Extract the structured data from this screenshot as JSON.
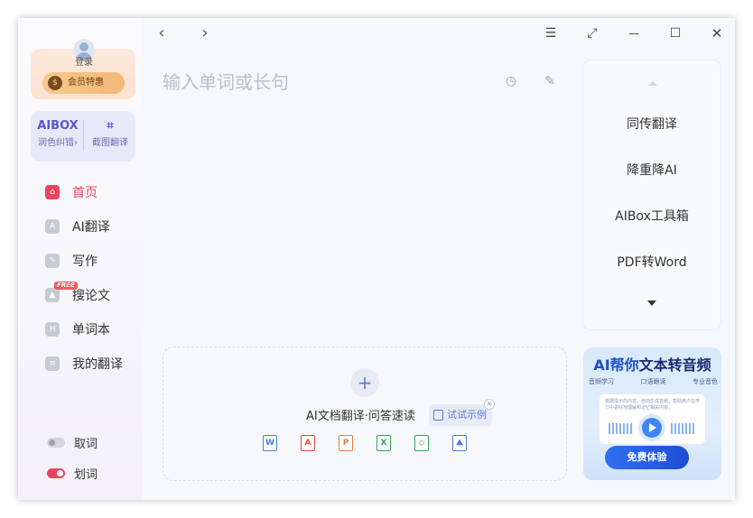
{
  "sidebar": {
    "login_label": "登录",
    "vip_label": "会员特惠",
    "vip_badge_glyph": "$",
    "tools": [
      {
        "logo": "AIBOX",
        "label": "润色纠错›"
      },
      {
        "logo": "⌗",
        "label": "截图翻译"
      }
    ],
    "nav": [
      {
        "label": "首页",
        "icon": "home-icon",
        "active": true
      },
      {
        "label": "AI翻译",
        "icon": "ai-translate-icon",
        "active": false
      },
      {
        "label": "写作",
        "icon": "pen-icon",
        "active": false
      },
      {
        "label": "搜论文",
        "icon": "graduation-cap-icon",
        "active": false,
        "tag": "FREE"
      },
      {
        "label": "单词本",
        "icon": "wordbook-icon",
        "active": false
      },
      {
        "label": "我的翻译",
        "icon": "document-icon",
        "active": false
      }
    ],
    "toggles": [
      {
        "label": "取词",
        "on": false
      },
      {
        "label": "划词",
        "on": true
      }
    ]
  },
  "topbar": {
    "back": "‹",
    "forward": "›",
    "menu": "☰",
    "pin": "⤢",
    "minimize": "—",
    "maximize": "☐",
    "close": "✕"
  },
  "main": {
    "placeholder": "输入单词或长句",
    "history_icon": "history-icon",
    "edit_icon": "edit-icon",
    "upload": {
      "plus": "+",
      "text": "AI文档翻译·问答速读",
      "example": "试试示例",
      "close": "×",
      "file_types": [
        {
          "glyph": "W",
          "color": "#4a7ce0"
        },
        {
          "glyph": "A",
          "color": "#e34b3a"
        },
        {
          "glyph": "P",
          "color": "#e8783a"
        },
        {
          "glyph": "X",
          "color": "#2fa35a"
        },
        {
          "glyph": "◇",
          "color": "#2fa35a"
        },
        {
          "glyph": "⛰",
          "color": "#4a7ce0"
        }
      ]
    }
  },
  "quick_panel": {
    "items": [
      "同传翻译",
      "降重降AI",
      "AIBox工具箱",
      "PDF转Word"
    ]
  },
  "banner": {
    "title_a": "AI帮你",
    "title_b": "文本转音频",
    "features": [
      "音频学习",
      "口语跟读",
      "专业音色"
    ],
    "card_text": "根据提示的内容，自动生成音频，帮助用户在学习中更好地理解和记忆相关内容。",
    "cta": "免费体验"
  },
  "colors": {
    "accent": "#e8465f",
    "brand_blue": "#1e4fc7"
  }
}
